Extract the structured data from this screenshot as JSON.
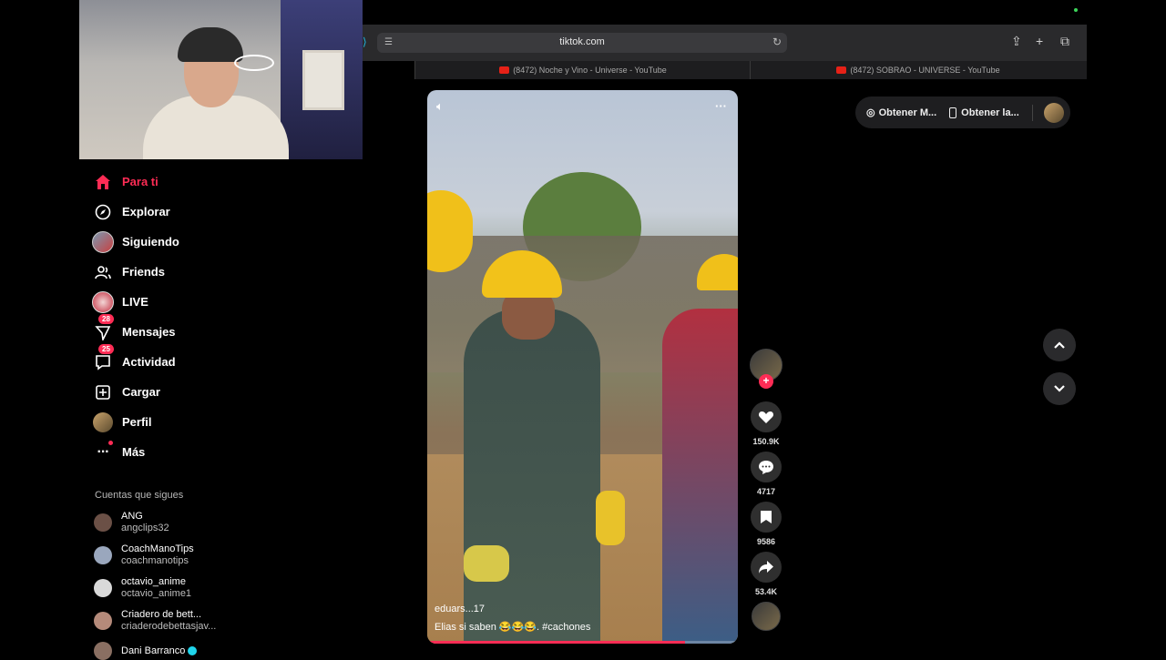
{
  "browser": {
    "url": "tiktok.com",
    "tabs": [
      {
        "title": "(8472) Noche y Vino - Universe - YouTube"
      },
      {
        "title": "(8472) SOBRAO - UNIVERSE - YouTube"
      }
    ]
  },
  "sidebar": {
    "items": [
      {
        "label": "Para ti",
        "icon": "home-icon",
        "active": true
      },
      {
        "label": "Explorar",
        "icon": "compass-icon"
      },
      {
        "label": "Siguiendo",
        "icon": "following-avatar"
      },
      {
        "label": "Friends",
        "icon": "friends-icon"
      },
      {
        "label": "LIVE",
        "icon": "live-avatar"
      },
      {
        "label": "Mensajes",
        "icon": "messages-icon",
        "badge": "28"
      },
      {
        "label": "Actividad",
        "icon": "activity-icon",
        "badge": "25"
      },
      {
        "label": "Cargar",
        "icon": "upload-icon"
      },
      {
        "label": "Perfil",
        "icon": "profile-avatar"
      },
      {
        "label": "Más",
        "icon": "more-icon"
      }
    ],
    "following_title": "Cuentas que sigues",
    "accounts": [
      {
        "name": "ANG",
        "handle": "angclips32"
      },
      {
        "name": "CoachManoTips",
        "handle": "coachmanotips"
      },
      {
        "name": "octavio_anime",
        "handle": "octavio_anime1"
      },
      {
        "name": "Criadero de bett...",
        "handle": "criaderodebettasjav..."
      },
      {
        "name": "Dani Barranco",
        "handle": ""
      }
    ]
  },
  "video": {
    "username": "eduars...17",
    "caption": "Elias si saben 😂😂😂. #cachones",
    "progress": 0.83
  },
  "actions": {
    "likes": "150.9K",
    "comments": "4717",
    "saves": "9586",
    "shares": "53.4K"
  },
  "top_pill": {
    "item1": "Obtener M...",
    "item2": "Obtener la..."
  },
  "colors": {
    "accent": "#fe2c55",
    "background": "#000000"
  }
}
